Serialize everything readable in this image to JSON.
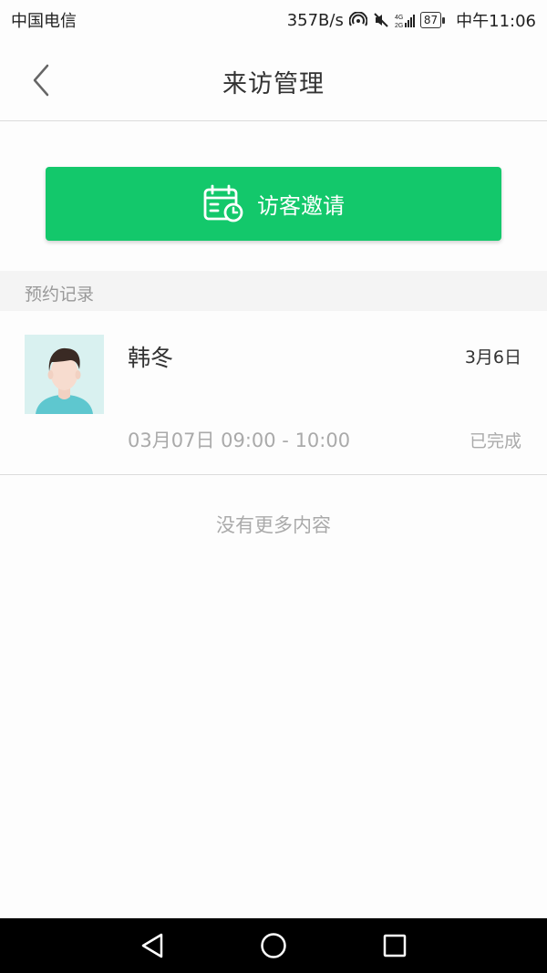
{
  "status_bar": {
    "carrier": "中国电信",
    "speed": "357B/s",
    "network": "4G 2G",
    "battery": "87",
    "time": "中午11:06"
  },
  "header": {
    "title": "来访管理",
    "back_icon": "chevron-left-icon"
  },
  "invite_button": {
    "label": "访客邀请",
    "icon": "calendar-clock-icon",
    "color": "#13c86b"
  },
  "records_section": {
    "title": "预约记录",
    "items": [
      {
        "name": "韩冬",
        "date": "3月6日",
        "time_range": "03月07日 09:00 - 10:00",
        "status": "已完成"
      }
    ]
  },
  "footer_text": "没有更多内容",
  "system_nav": {
    "back": "triangle-back-icon",
    "home": "circle-home-icon",
    "recents": "square-recents-icon"
  }
}
